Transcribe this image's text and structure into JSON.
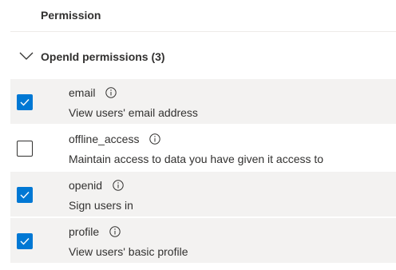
{
  "table": {
    "column_header": "Permission"
  },
  "group": {
    "label": "OpenId permissions (3)",
    "expanded": true
  },
  "permissions": [
    {
      "name": "email",
      "description": "View users' email address",
      "checked": true
    },
    {
      "name": "offline_access",
      "description": "Maintain access to data you have given it access to",
      "checked": false
    },
    {
      "name": "openid",
      "description": "Sign users in",
      "checked": true
    },
    {
      "name": "profile",
      "description": "View users' basic profile",
      "checked": true
    }
  ],
  "colors": {
    "accent": "#0078d4",
    "selected_row": "#f3f2f1",
    "text": "#323130"
  },
  "icons": {
    "group_toggle": "chevron-down-icon",
    "info": "info-icon",
    "check": "checkmark-icon"
  }
}
